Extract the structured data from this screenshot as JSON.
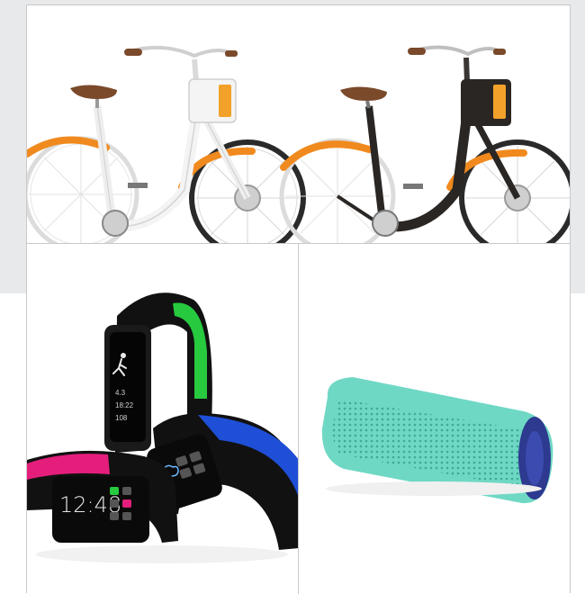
{
  "panels": {
    "top": {
      "subject": "two electric city bicycles"
    },
    "bottom_left": {
      "subject": "fitness tracker wristbands"
    },
    "bottom_right": {
      "subject": "portable bluetooth speaker"
    }
  },
  "bikes": {
    "white": {
      "frame_color": "#f4f4f4",
      "fender_color": "#f08a1e"
    },
    "black": {
      "frame_color": "#2a2624",
      "fender_color": "#f08a1e"
    },
    "battery_label_color": "#f2a12a"
  },
  "wristbands": {
    "pink_band": {
      "accent": "#e51e7c",
      "time": "12:48"
    },
    "green_band": {
      "accent": "#27c93f"
    },
    "blue_band": {
      "accent": "#1f4fd6"
    },
    "screen_values": [
      "4.3",
      "18:22",
      "108"
    ]
  },
  "speaker": {
    "color": "#6fd8c4",
    "end_cap_color": "#2d3a8f"
  }
}
